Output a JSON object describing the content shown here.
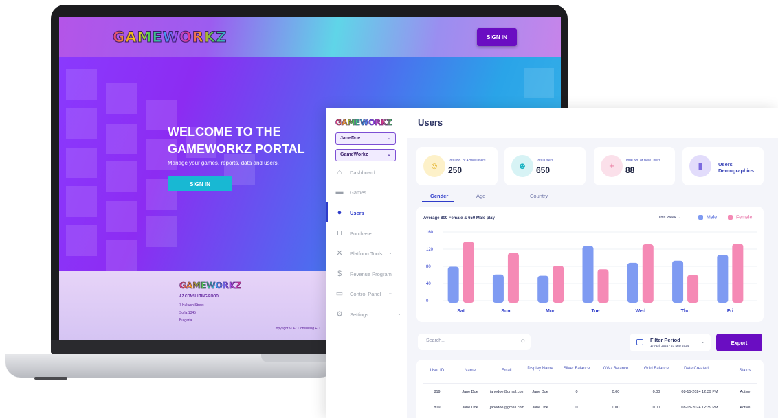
{
  "landing": {
    "logo": "GAMEWORKZ",
    "sign_in": "SIGN IN",
    "hero_title": "WELCOME TO THE GAMEWORKZ PORTAL",
    "hero_subtitle": "Manage your games, reports, data and users.",
    "hero_button": "SIGN IN",
    "footer": {
      "logo": "GAMEWORKZ",
      "company": "AZ CONSULTING EOOD",
      "address_line1": "7 Kukush Street",
      "address_line2": "Sofia 1345",
      "address_line3": "Bulgaria",
      "copyright": "Copyright © AZ Consulting EO"
    }
  },
  "dashboard": {
    "logo": "GAMEWORKZ",
    "user_select": "JaneDoe",
    "org_select": "GameWorkz",
    "nav": [
      {
        "label": "Dashboard",
        "icon": "home-icon",
        "active": false,
        "chevron": false
      },
      {
        "label": "Games",
        "icon": "gamepad-icon",
        "active": false,
        "chevron": false
      },
      {
        "label": "Users",
        "icon": "user-icon",
        "active": true,
        "chevron": false
      },
      {
        "label": "Purchase",
        "icon": "cart-icon",
        "active": false,
        "chevron": false
      },
      {
        "label": "Platform Tools",
        "icon": "tools-icon",
        "active": false,
        "chevron": true
      },
      {
        "label": "Revenue Program",
        "icon": "revenue-icon",
        "active": false,
        "chevron": false
      },
      {
        "label": "Control Panel",
        "icon": "control-panel-icon",
        "active": false,
        "chevron": true
      },
      {
        "label": "Settings",
        "icon": "gear-icon",
        "active": false,
        "chevron": true
      }
    ],
    "page_title": "Users",
    "stats": [
      {
        "label": "Total No. of Active Users",
        "value": "250",
        "icon": "active-users-icon",
        "color": "#fdf1c9",
        "icon_color": "#e3b32a"
      },
      {
        "label": "Total Users",
        "value": "650",
        "icon": "users-group-icon",
        "color": "#d7f3f5",
        "icon_color": "#1bb3c2"
      },
      {
        "label": "Total No. of New Users",
        "value": "88",
        "icon": "new-users-icon",
        "color": "#fbe0ea",
        "icon_color": "#e8729a"
      }
    ],
    "demographics_card": {
      "label": "Users Demographics",
      "icon": "bar-chart-icon"
    },
    "tabs": [
      "Gender",
      "Age",
      "Country"
    ],
    "active_tab": "Gender",
    "chart": {
      "subtitle": "Average 800 Female & 650 Male play",
      "period_select": "This Week",
      "legend": [
        {
          "name": "Male",
          "color": "#7f9bf2"
        },
        {
          "name": "Female",
          "color": "#f58ab5"
        }
      ]
    },
    "search": {
      "placeholder": "Search..."
    },
    "filter": {
      "title": "Filter Period",
      "range": "17 April 2024 - 21 May 2024"
    },
    "export_label": "Export",
    "table": {
      "columns": [
        "User ID",
        "Name",
        "Email",
        "Display Name",
        "Silver Balance",
        "GWz Balance",
        "Gold Balance",
        "Date Created",
        "Status"
      ],
      "rows": [
        [
          "819",
          "Jane Doe",
          "janedoe@gmail.com",
          "Jane Doe",
          "0",
          "0.00",
          "0.00",
          "08-15-2024 12:39 PM",
          "Active"
        ],
        [
          "819",
          "Jane Doe",
          "janedoe@gmail.com",
          "Jane Doe",
          "0",
          "0.00",
          "0.00",
          "08-15-2024 12:39 PM",
          "Active"
        ]
      ]
    }
  },
  "chart_data": {
    "type": "bar",
    "categories": [
      "Sat",
      "Sun",
      "Mon",
      "Tue",
      "Wed",
      "Thu",
      "Fri"
    ],
    "series": [
      {
        "name": "Male",
        "values": [
          84,
          66,
          63,
          132,
          93,
          98,
          112
        ]
      },
      {
        "name": "Female",
        "values": [
          142,
          116,
          86,
          78,
          136,
          65,
          137
        ]
      }
    ],
    "yticks": [
      0,
      40,
      80,
      120,
      160
    ],
    "ylim": [
      0,
      160
    ],
    "subtitle": "Average 800 Female & 650 Male play",
    "legend_position": "top-right",
    "grid": true
  }
}
